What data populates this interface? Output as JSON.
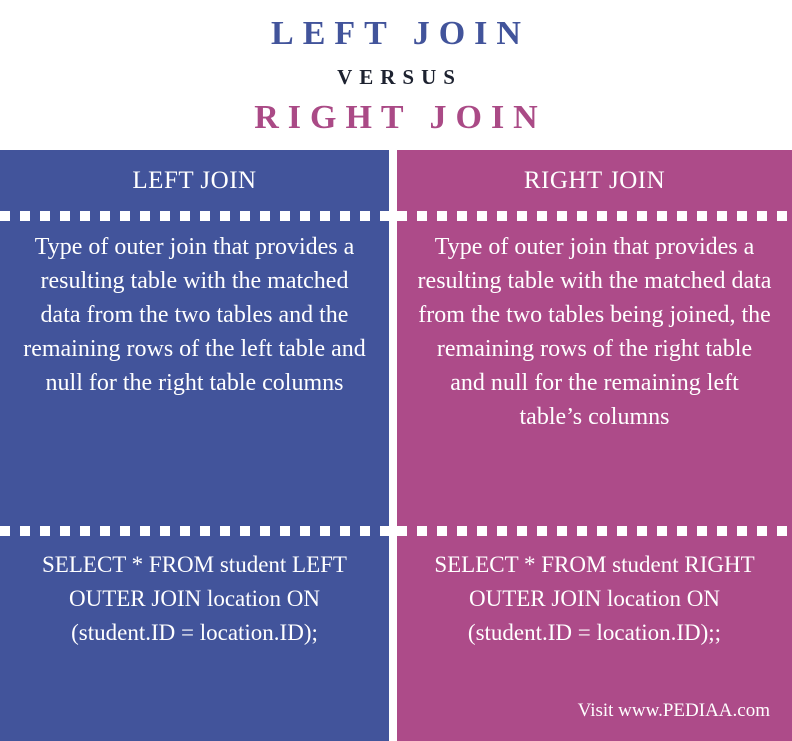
{
  "title": {
    "main": "LEFT JOIN",
    "versus": "VERSUS",
    "sub": "RIGHT JOIN",
    "main_color": "#42549b",
    "versus_color": "#1d2230",
    "sub_color": "#aa4a86"
  },
  "comparison": {
    "left": {
      "heading": "LEFT JOIN",
      "description": "Type of outer join that provides a resulting table with the matched data from the two tables and the remaining rows of the left table and null for the right table columns",
      "code": "SELECT * FROM student LEFT OUTER JOIN location ON (student.ID = location.ID);",
      "background_color": "#42549b"
    },
    "right": {
      "heading": "RIGHT JOIN",
      "description": "Type of outer join that provides a resulting table with the matched data from the two tables being joined, the remaining rows of the right table and null for the remaining left table’s columns",
      "code": "SELECT * FROM student RIGHT OUTER JOIN location ON (student.ID = location.ID);;",
      "background_color": "#ad4b89"
    }
  },
  "footer": {
    "credit": "Visit www.PEDIAA.com"
  }
}
